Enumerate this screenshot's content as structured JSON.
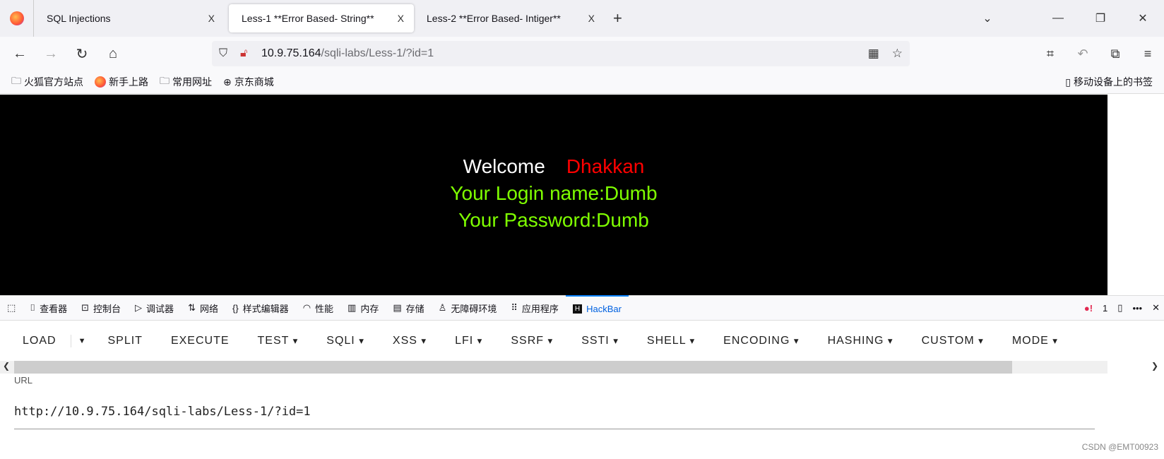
{
  "tabs": [
    {
      "title": "SQL Injections",
      "active": false
    },
    {
      "title": "Less-1 **Error Based- String**",
      "active": true
    },
    {
      "title": "Less-2 **Error Based- Intiger**",
      "active": false
    }
  ],
  "close_glyph": "X",
  "url": {
    "host": "10.9.75.164",
    "path": "/sqli-labs/Less-1/?id=1"
  },
  "bookmarks": [
    "火狐官方站点",
    "新手上路",
    "常用网址",
    "京东商城"
  ],
  "bookmarks_mobile": "移动设备上的书签",
  "page": {
    "welcome": "Welcome",
    "name": "Dhakkan",
    "login": "Your Login name:Dumb",
    "password": "Your Password:Dumb"
  },
  "devtools": {
    "tabs": [
      "查看器",
      "控制台",
      "调试器",
      "网络",
      "样式编辑器",
      "性能",
      "内存",
      "存储",
      "无障碍环境",
      "应用程序",
      "HackBar"
    ],
    "active": "HackBar",
    "error_count": "1"
  },
  "hackbar": {
    "buttons": [
      "LOAD",
      "SPLIT",
      "EXECUTE",
      "TEST",
      "SQLI",
      "XSS",
      "LFI",
      "SSRF",
      "SSTI",
      "SHELL",
      "ENCODING",
      "HASHING",
      "CUSTOM",
      "MODE"
    ],
    "url_label": "URL",
    "url_value": "http://10.9.75.164/sqli-labs/Less-1/?id=1"
  },
  "watermark": "CSDN @EMT00923"
}
